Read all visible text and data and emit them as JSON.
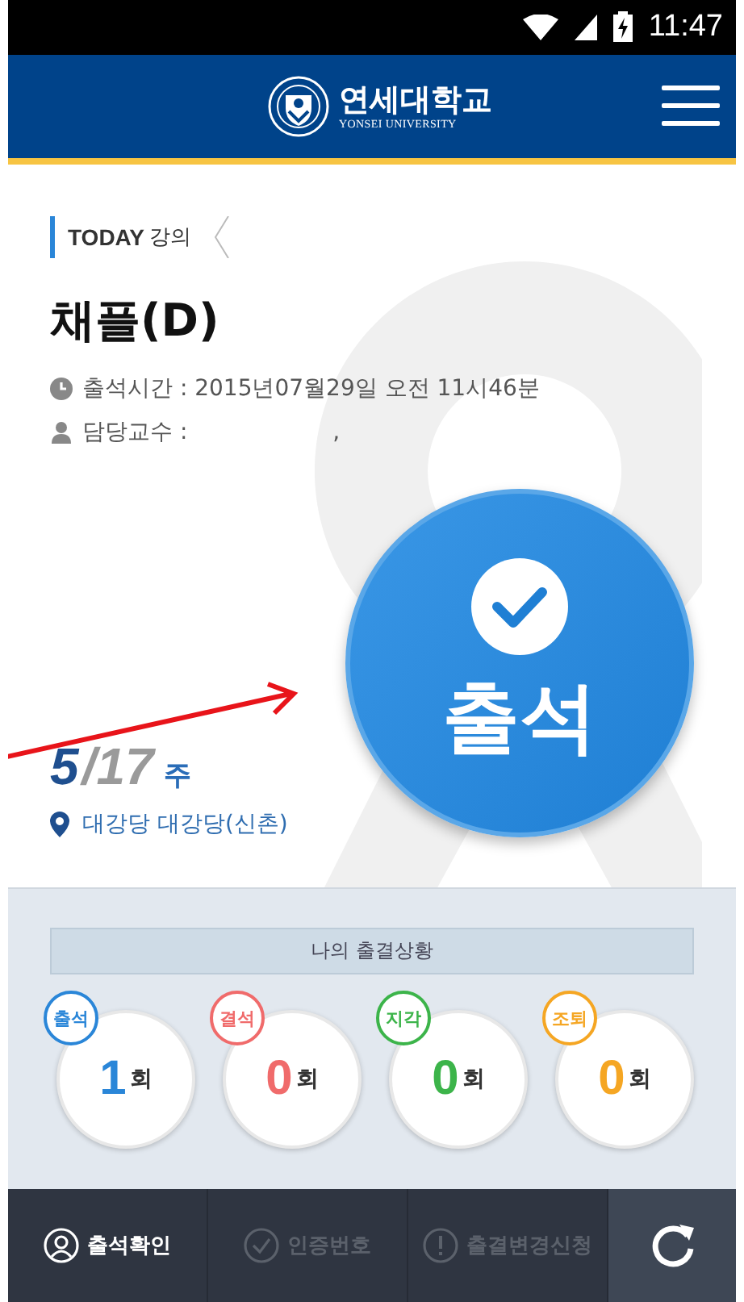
{
  "status_bar": {
    "time": "11:47"
  },
  "header": {
    "logo_korean": "연세대학교",
    "logo_english": "YONSEI UNIVERSITY"
  },
  "lecture": {
    "tag_bold": "TODAY",
    "tag_text": "강의",
    "title": "채플(D)",
    "time_label": "출석시간 :",
    "time_value": "2015년07월29일 오전 11시46분",
    "professor_label": "담당교수 :",
    "professor_value": ",",
    "week_current": "5",
    "week_total": "/17",
    "week_unit": "주",
    "location": "대강당 대강당(신촌)"
  },
  "attend_button": {
    "label": "출석"
  },
  "stats": {
    "title": "나의 출결상황",
    "items": [
      {
        "label": "출석",
        "count": "1",
        "unit": "회",
        "color": "#2a86d8"
      },
      {
        "label": "결석",
        "count": "0",
        "unit": "회",
        "color": "#f06b6b"
      },
      {
        "label": "지각",
        "count": "0",
        "unit": "회",
        "color": "#3cb44a"
      },
      {
        "label": "조퇴",
        "count": "0",
        "unit": "회",
        "color": "#f5a623"
      }
    ]
  },
  "bottom_nav": {
    "tabs": [
      {
        "kind": "person",
        "label": "출석확인",
        "selected": true
      },
      {
        "kind": "check",
        "label": "인증번호",
        "selected": false
      },
      {
        "kind": "alert",
        "label": "출결변경신청",
        "selected": false
      }
    ]
  }
}
